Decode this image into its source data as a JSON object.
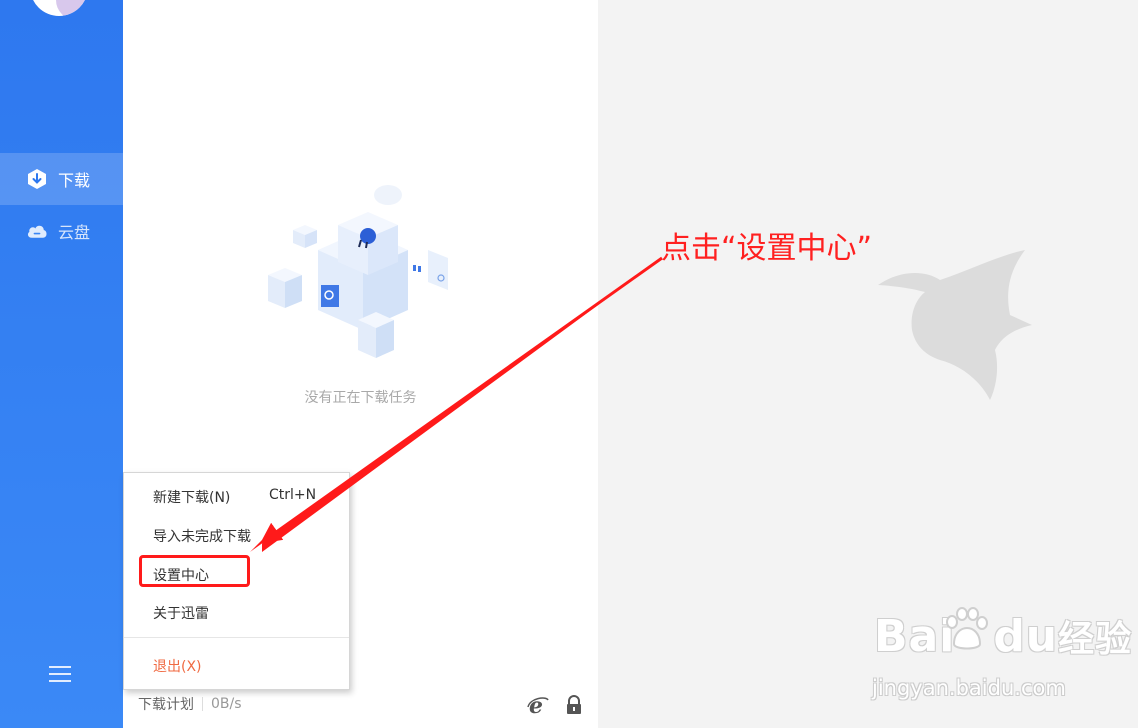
{
  "sidebar": {
    "items": [
      {
        "label": "下载",
        "icon": "download-icon",
        "active": true
      },
      {
        "label": "云盘",
        "icon": "cloud-icon",
        "active": false
      }
    ],
    "menu_icon": "hamburger-menu-icon"
  },
  "main": {
    "empty_text": "没有正在下载任务",
    "illustration_icon": "empty-boxes-illustration"
  },
  "status_bar": {
    "plan_label": "下载计划",
    "speed": "0B/s",
    "icons": [
      "ie-icon",
      "lock-icon"
    ]
  },
  "context_menu": {
    "items": [
      {
        "label": "新建下载(N)",
        "shortcut": "Ctrl+N"
      },
      {
        "label": "导入未完成下载",
        "shortcut": ""
      },
      {
        "label": "设置中心",
        "shortcut": "",
        "highlighted": true
      },
      {
        "label": "关于迅雷",
        "shortcut": ""
      },
      {
        "label": "退出(X)",
        "shortcut": "",
        "color": "#f06a42"
      }
    ]
  },
  "annotation": {
    "text": "点击“设置中心”",
    "color": "#ff2020"
  },
  "watermark": {
    "logo_text": "Bai",
    "logo_text2": "du",
    "logo_text3": "经验",
    "url": "jingyan.baidu.com",
    "icon": "hummingbird-logo-icon"
  },
  "colors": {
    "sidebar": "#2e78ef",
    "accent_red": "#ff2020",
    "exit": "#f06a42"
  }
}
